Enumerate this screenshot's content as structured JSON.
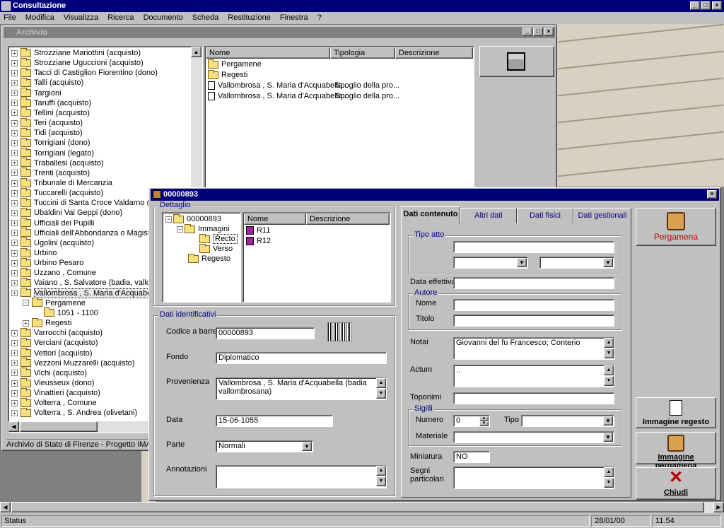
{
  "app": {
    "title": "Consultazione"
  },
  "menu": [
    "File",
    "Modifica",
    "Visualizza",
    "Ricerca",
    "Documento",
    "Scheda",
    "Restituzione",
    "Finestra",
    "?"
  ],
  "archive_window": {
    "title": "Archivio",
    "tree": [
      "Strozziane Mariottini (acquisto)",
      "Strozziane Uguccioni (acquisto)",
      "Tacci di Castiglion Fiorentino (dono)",
      "Talli (acquisto)",
      "Targioni",
      "Taruffi (acquisto)",
      "Tellini (acquisto)",
      "Teri (acquisto)",
      "Tidi (acquisto)",
      "Torrigiani (dono)",
      "Torrigiani (legato)",
      "Traballesi (acquisto)",
      "Trenti (acquisto)",
      "Tribunale di Mercanzia",
      "Tuccarelli (acquisto)",
      "Tuccini di Santa Croce Valdarno (dono)",
      "Ubaldini Vai Geppi (dono)",
      "Ufficiali dei Pupilli",
      "Ufficiali dell'Abbondanza o Magistrato",
      "Ugolini (acquisto)",
      "Urbino",
      "Urbino Pesaro",
      "Uzzano , Comune",
      "Vaiano , S. Salvatore (badia, vallombr",
      "Vallombrosa , S. Maria d'Acquabella (b"
    ],
    "tree_sub": [
      "Pergamene",
      "1051 - 1100",
      "Regesti"
    ],
    "tree_after": [
      "Varrocchi (acquisto)",
      "Verciani (acquisto)",
      "Vettori (acquisto)",
      "Vezzoni Muzzarelli (acquisto)",
      "Vichi (acquisto)",
      "Vieusseux (dono)",
      "Vinattieri (acquisto)",
      "Volterra , Comune",
      "Volterra , S. Andrea (olivetani)"
    ],
    "list_headers": [
      "Nome",
      "Tipologia",
      "Descrizione"
    ],
    "list_rows": [
      {
        "name": "Pergamene",
        "type": "",
        "desc": ""
      },
      {
        "name": "Regesti",
        "type": "",
        "desc": ""
      },
      {
        "name": "Vallombrosa , S. Maria d'Acquabella...",
        "type": "Spoglio della pro...",
        "desc": ""
      },
      {
        "name": "Vallombrosa , S. Maria d'Acquabella...",
        "type": "Spoglio della pro...",
        "desc": ""
      }
    ],
    "footer": "Archivio di Stato di Firenze - Progetto IMAGO\\D"
  },
  "detail_window": {
    "title": "00000893",
    "dettaglio": "Dettaglio",
    "tree": [
      "00000893",
      "Immagini",
      "Recto",
      "Verso",
      "Regesto"
    ],
    "list_headers": [
      "Nome",
      "Descrizione"
    ],
    "list_rows": [
      "R11",
      "R12"
    ],
    "dati_identificativi": "Dati identificativi",
    "fields": {
      "codice_label": "Codice a barre",
      "codice_value": "00000893",
      "fondo_label": "Fondo",
      "fondo_value": "Diplomatico",
      "provenienza_label": "Provenienza",
      "provenienza_value": "Vallombrosa , S. Maria d'Acquabella (badia vallombrosana)",
      "data_label": "Data",
      "data_value": "15-06-1055",
      "parte_label": "Parte",
      "parte_value": "Normali",
      "annotazioni_label": "Annotazioni"
    },
    "tabs": [
      "Dati contenuto",
      "Altri dati",
      "Dati fisici",
      "Dati gestionali"
    ],
    "contenuto": {
      "tipo_atto": "Tipo atto",
      "data_effettiva": "Data effettiva",
      "autore": "Autore",
      "nome": "Nome",
      "titolo": "Titolo",
      "notai": "Notai",
      "notai_value": "Giovanni del fu Francesco; Conterio",
      "actum": "Actum",
      "actum_value": "..",
      "toponimi": "Toponimi",
      "sigilli": "Sigilli",
      "numero": "Numero",
      "numero_value": "0",
      "tipo": "Tipo",
      "materiale": "Materiale",
      "miniatura": "Miniatura",
      "miniatura_value": "NO",
      "segni": "Segni particolari"
    },
    "side": {
      "pergamena": "Pergamena",
      "immagine_regesto": "Immagine regesto",
      "immagine_pergamena": "Immagine pergamena",
      "chiudi": "Chiudi"
    }
  },
  "statusbar": {
    "status": "Status",
    "date": "28/01/00",
    "time": "11.54"
  },
  "colors": {
    "titlebar": "#00007b",
    "accent_red": "#c00000",
    "link_blue": "#000080"
  }
}
